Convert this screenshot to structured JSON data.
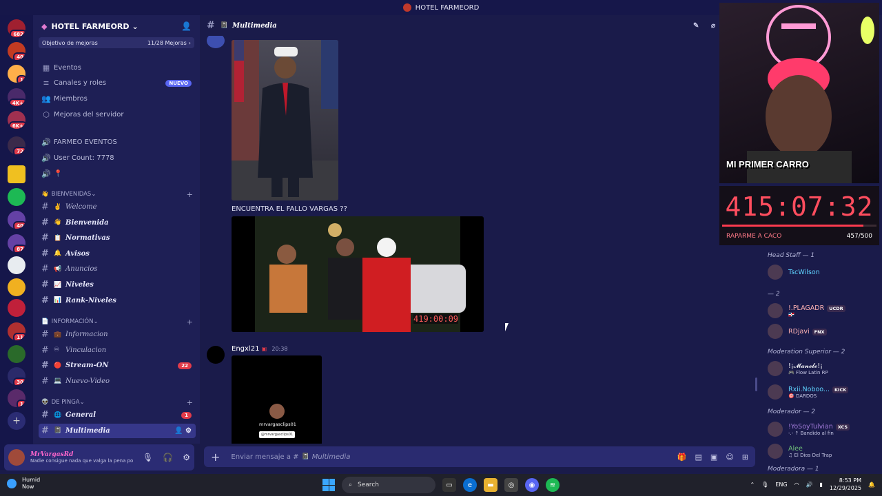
{
  "window": {
    "title": "HOTEL FARMEORD"
  },
  "rail": {
    "badges": [
      "682",
      "40",
      "1",
      "4K+",
      "6K+",
      "72",
      "40",
      "87",
      "11",
      "30",
      "1",
      "2"
    ]
  },
  "server": {
    "name": "HOTEL FARMEORD",
    "boost": {
      "label": "Objetivo de mejoras",
      "progress": "11/28 Mejoras"
    },
    "nav": [
      {
        "label": "Eventos",
        "icon": "calendar-icon"
      },
      {
        "label": "Canales y roles",
        "icon": "list-icon",
        "badge": "NUEVO"
      },
      {
        "label": "Miembros",
        "icon": "members-icon"
      },
      {
        "label": "Mejoras del servidor",
        "icon": "boost-icon"
      }
    ],
    "voice": [
      {
        "label": "FARMEO EVENTOS"
      },
      {
        "label": "User Count: 7778"
      },
      {
        "label": "📍"
      }
    ],
    "categories": [
      {
        "name": "BIENVENIDAS",
        "emoji": "👋",
        "channels": [
          {
            "label": "Welcome",
            "emoji": "✌",
            "bold": false
          },
          {
            "label": "Bienvenida",
            "emoji": "👋",
            "bold": true
          },
          {
            "label": "Normativas",
            "emoji": "📋",
            "bold": true
          },
          {
            "label": "Avisos",
            "emoji": "🔔",
            "bold": true
          },
          {
            "label": "Anuncios",
            "emoji": "📢",
            "bold": false
          },
          {
            "label": "Niveles",
            "emoji": "📈",
            "bold": true
          },
          {
            "label": "Rank-Niveles",
            "emoji": "📊",
            "bold": true
          }
        ]
      },
      {
        "name": "INFORMACIÓN",
        "emoji": "📄",
        "channels": [
          {
            "label": "Informacion",
            "emoji": "💼",
            "bold": false
          },
          {
            "label": "Vinculacion",
            "emoji": "♾",
            "bold": false
          },
          {
            "label": "Stream-ON",
            "emoji": "🔴",
            "bold": true,
            "count": "22"
          },
          {
            "label": "Nuevo-Video",
            "emoji": "💻",
            "bold": false
          }
        ]
      },
      {
        "name": "DE PINGA",
        "emoji": "👽",
        "channels": [
          {
            "label": "General",
            "emoji": "🌐",
            "bold": true,
            "count": "1"
          },
          {
            "label": "Multimedia",
            "emoji": "📓",
            "bold": true,
            "selected": true
          }
        ]
      }
    ]
  },
  "user": {
    "name": "MrVargasRd",
    "status": "Nadie consigue nada que valga la pena po..."
  },
  "channel": {
    "name": "Multimedia"
  },
  "messages": {
    "caption": "ENCUENTRA EL FALLO VARGAS ??",
    "video_timer": "419:00:09",
    "author": "Engxl21",
    "time": "20:38",
    "tiktok_user": "mrvargasclips01",
    "tiktok_handle": "@mrvargasclips01"
  },
  "composer": {
    "placeholder": "Enviar mensaje a #",
    "channel": "Multimedia"
  },
  "stream": {
    "overlay": "MI PRIMER CARRO",
    "timer": "415:07:32",
    "goal_label": "RAPARME A CACO",
    "goal_progress": "457/500",
    "goal_fraction": 0.914
  },
  "members": {
    "groups": [
      {
        "title": "Head Staff — 1",
        "members": [
          {
            "name": "TscWilson",
            "color": "#5fd3ff"
          }
        ]
      },
      {
        "title": "— 2",
        "members": [
          {
            "name": "!.PLAGADR",
            "color": "#ffb3b3",
            "tag": "UCDR",
            "sub": "🇩🇴"
          },
          {
            "name": "RDjavi",
            "color": "#ffb3b3",
            "tag": "FNX"
          }
        ]
      },
      {
        "title": "Moderation Superior — 2",
        "members": [
          {
            "name": "!¡𝓜𝓪𝓷𝓮𝓵𝓸!¡",
            "color": "#ffffff",
            "sub": "🎮 Flow Latin RP"
          },
          {
            "name": "Rxii.Noboo...",
            "color": "#5fd3ff",
            "tag": "KICK",
            "sub": "🎯 DARDOS"
          }
        ]
      },
      {
        "title": "Moderador — 2",
        "members": [
          {
            "name": "!YoSoyTulvian",
            "color": "#a07ad8",
            "tag": "XCS",
            "sub": "-.- ↑ Bandido al fin"
          },
          {
            "name": "Alee",
            "color": "#6fbf7a",
            "sub": "♫ El Dios Del Trap"
          }
        ]
      },
      {
        "title": "Moderadora — 1",
        "members": []
      }
    ]
  },
  "taskbar": {
    "weather": {
      "label": "Humid",
      "sub": "Now"
    },
    "search": "Search",
    "lang": "ENG",
    "time": "8:53 PM",
    "date": "12/29/2025"
  }
}
